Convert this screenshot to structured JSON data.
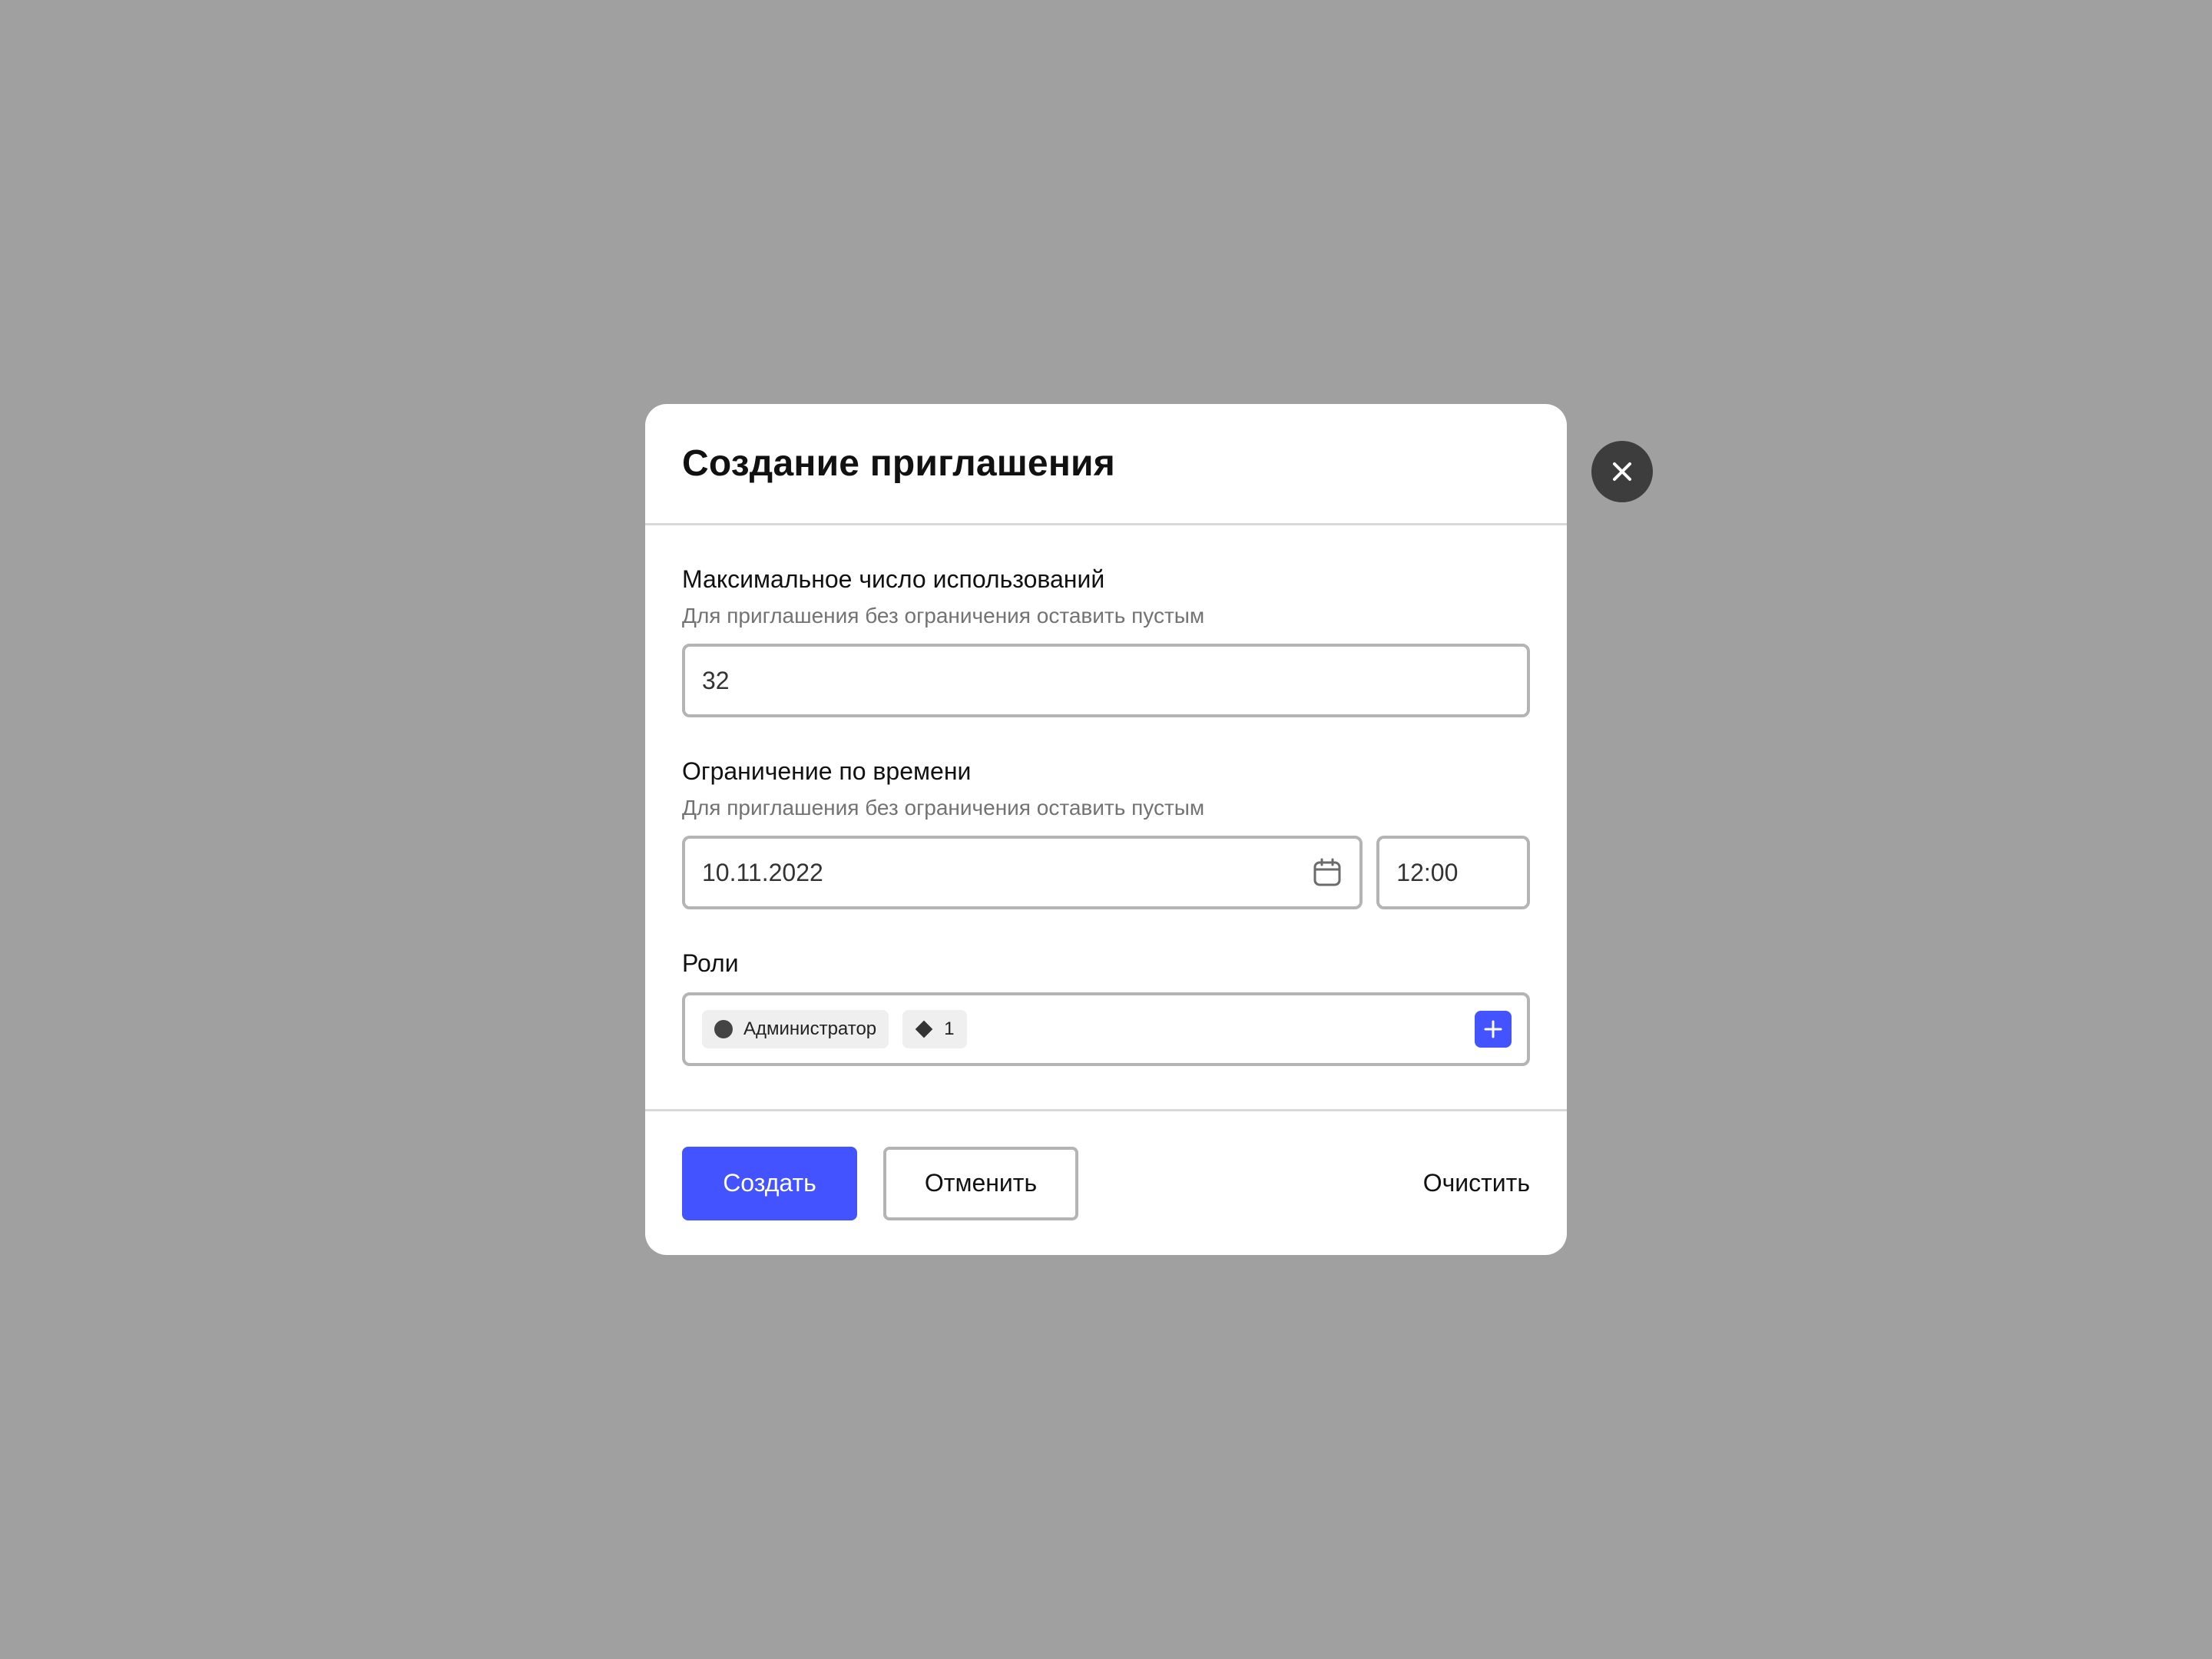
{
  "modal": {
    "title": "Создание приглашения"
  },
  "fields": {
    "max_uses": {
      "label": "Максимальное число использований",
      "hint": "Для приглашения без ограничения оставить пустым",
      "value": "32"
    },
    "time_limit": {
      "label": "Ограничение по времени",
      "hint": "Для приглашения без ограничения оставить пустым",
      "date_value": "10.11.2022",
      "time_value": "12:00"
    },
    "roles": {
      "label": "Роли",
      "chips": [
        {
          "label": "Администратор",
          "icon": "circle-icon"
        },
        {
          "label": "1",
          "icon": "diamond-icon"
        }
      ]
    }
  },
  "footer": {
    "create_label": "Создать",
    "cancel_label": "Отменить",
    "clear_label": "Очистить"
  },
  "colors": {
    "accent": "#4353ff",
    "backdrop": "#a0a0a0",
    "close_button": "#3d3d3d"
  }
}
